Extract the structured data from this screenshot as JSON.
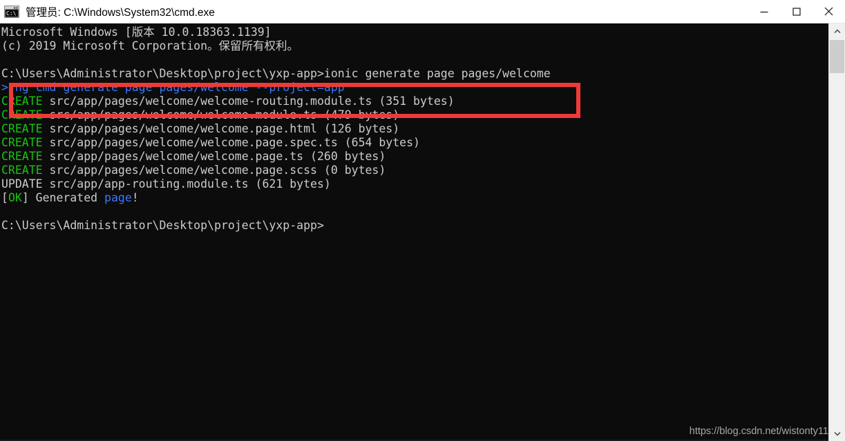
{
  "window": {
    "title": "管理员: C:\\Windows\\System32\\cmd.exe",
    "icon": "cmd-console-icon",
    "background_color": "#0c0c0c",
    "titlebar_color": "#ffffff"
  },
  "window_controls": {
    "minimize_label": "—",
    "maximize_label": "▢",
    "close_label": "✕"
  },
  "terminal": {
    "foreground_color": "#cccccc",
    "green_color": "#16c60c",
    "blue_color": "#3b78ff",
    "lines": [
      {
        "id": "line-version",
        "segments": [
          {
            "text": "Microsoft Windows [版本 10.0.18363.1139]",
            "color": "white"
          }
        ]
      },
      {
        "id": "line-copyright",
        "segments": [
          {
            "text": "(c) 2019 Microsoft Corporation。保留所有权利。",
            "color": "white"
          }
        ]
      },
      {
        "id": "line-blank-1",
        "segments": [
          {
            "text": "",
            "color": "white"
          }
        ]
      },
      {
        "id": "line-command-prompt",
        "segments": [
          {
            "text": "C:\\Users\\Administrator\\Desktop\\project\\yxp-app>ionic generate page pages/welcome",
            "color": "white"
          }
        ]
      },
      {
        "id": "line-ng-cmd",
        "segments": [
          {
            "text": "> ng cmd generate page pages/welcome --project=app",
            "color": "blue"
          }
        ]
      },
      {
        "id": "line-create-routing-module",
        "segments": [
          {
            "text": "CREATE",
            "color": "green"
          },
          {
            "text": " src/app/pages/welcome/welcome-routing.module.ts (351 bytes)",
            "color": "white"
          }
        ]
      },
      {
        "id": "line-create-module",
        "segments": [
          {
            "text": "CREATE",
            "color": "green"
          },
          {
            "text": " src/app/pages/welcome/welcome.module.ts (479 bytes)",
            "color": "white"
          }
        ]
      },
      {
        "id": "line-create-html",
        "segments": [
          {
            "text": "CREATE",
            "color": "green"
          },
          {
            "text": " src/app/pages/welcome/welcome.page.html (126 bytes)",
            "color": "white"
          }
        ]
      },
      {
        "id": "line-create-spec",
        "segments": [
          {
            "text": "CREATE",
            "color": "green"
          },
          {
            "text": " src/app/pages/welcome/welcome.page.spec.ts (654 bytes)",
            "color": "white"
          }
        ]
      },
      {
        "id": "line-create-ts",
        "segments": [
          {
            "text": "CREATE",
            "color": "green"
          },
          {
            "text": " src/app/pages/welcome/welcome.page.ts (260 bytes)",
            "color": "white"
          }
        ]
      },
      {
        "id": "line-create-scss",
        "segments": [
          {
            "text": "CREATE",
            "color": "green"
          },
          {
            "text": " src/app/pages/welcome/welcome.page.scss (0 bytes)",
            "color": "white"
          }
        ]
      },
      {
        "id": "line-update-app-routing",
        "segments": [
          {
            "text": "UPDATE src/app/app-routing.module.ts (621 bytes)",
            "color": "white"
          }
        ]
      },
      {
        "id": "line-ok-generated",
        "segments": [
          {
            "text": "[",
            "color": "white"
          },
          {
            "text": "OK",
            "color": "green"
          },
          {
            "text": "] Generated ",
            "color": "white"
          },
          {
            "text": "page",
            "color": "blue"
          },
          {
            "text": "!",
            "color": "white"
          }
        ]
      },
      {
        "id": "line-blank-2",
        "segments": [
          {
            "text": "",
            "color": "white"
          }
        ]
      },
      {
        "id": "line-final-prompt",
        "segments": [
          {
            "text": "C:\\Users\\Administrator\\Desktop\\project\\yxp-app>",
            "color": "white"
          }
        ]
      }
    ]
  },
  "annotation": {
    "shape": "rectangle",
    "color": "#f03a36",
    "highlighted_text": "C:\\Users\\Administrator\\Desktop\\project\\yxp-app>ionic generate page pages/welcome"
  },
  "scrollbar": {
    "up_arrow": "▲",
    "down_arrow": "▼",
    "thumb_position": "near-top"
  },
  "watermark": {
    "text": "https://blog.csdn.net/wistonty11"
  }
}
